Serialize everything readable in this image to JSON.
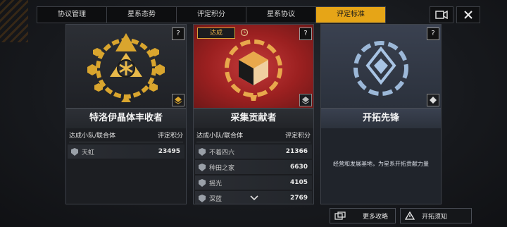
{
  "tabs": [
    "协议管理",
    "星系态势",
    "评定积分",
    "星系协议",
    "评定标准"
  ],
  "active_tab": 4,
  "top_icons": [
    "video-camera-icon",
    "close-icon"
  ],
  "colors": {
    "accent": "#e6a517",
    "red_card": "#a72525",
    "blue_card": "#2b313c"
  },
  "cards": [
    {
      "title": "特洛伊晶体丰收者",
      "help": "?",
      "header_left": "达成小队/联合体",
      "header_right": "评定积分",
      "rows": [
        {
          "name": "天虹",
          "score": "23495"
        }
      ]
    },
    {
      "badge": "达成",
      "title": "采集贡献者",
      "help": "?",
      "header_left": "达成小队/联合体",
      "header_right": "评定积分",
      "rows": [
        {
          "name": "不着四六",
          "score": "21366"
        },
        {
          "name": "种田之家",
          "score": "6630"
        },
        {
          "name": "摇光",
          "score": "4105"
        },
        {
          "name": "深蓝",
          "score": "2769"
        }
      ]
    },
    {
      "title": "开拓先锋",
      "help": "?",
      "description": "经营和发展基地，为星系开拓贡献力量"
    }
  ],
  "bottom": {
    "more": "更多攻略",
    "notice": "开拓须知"
  }
}
